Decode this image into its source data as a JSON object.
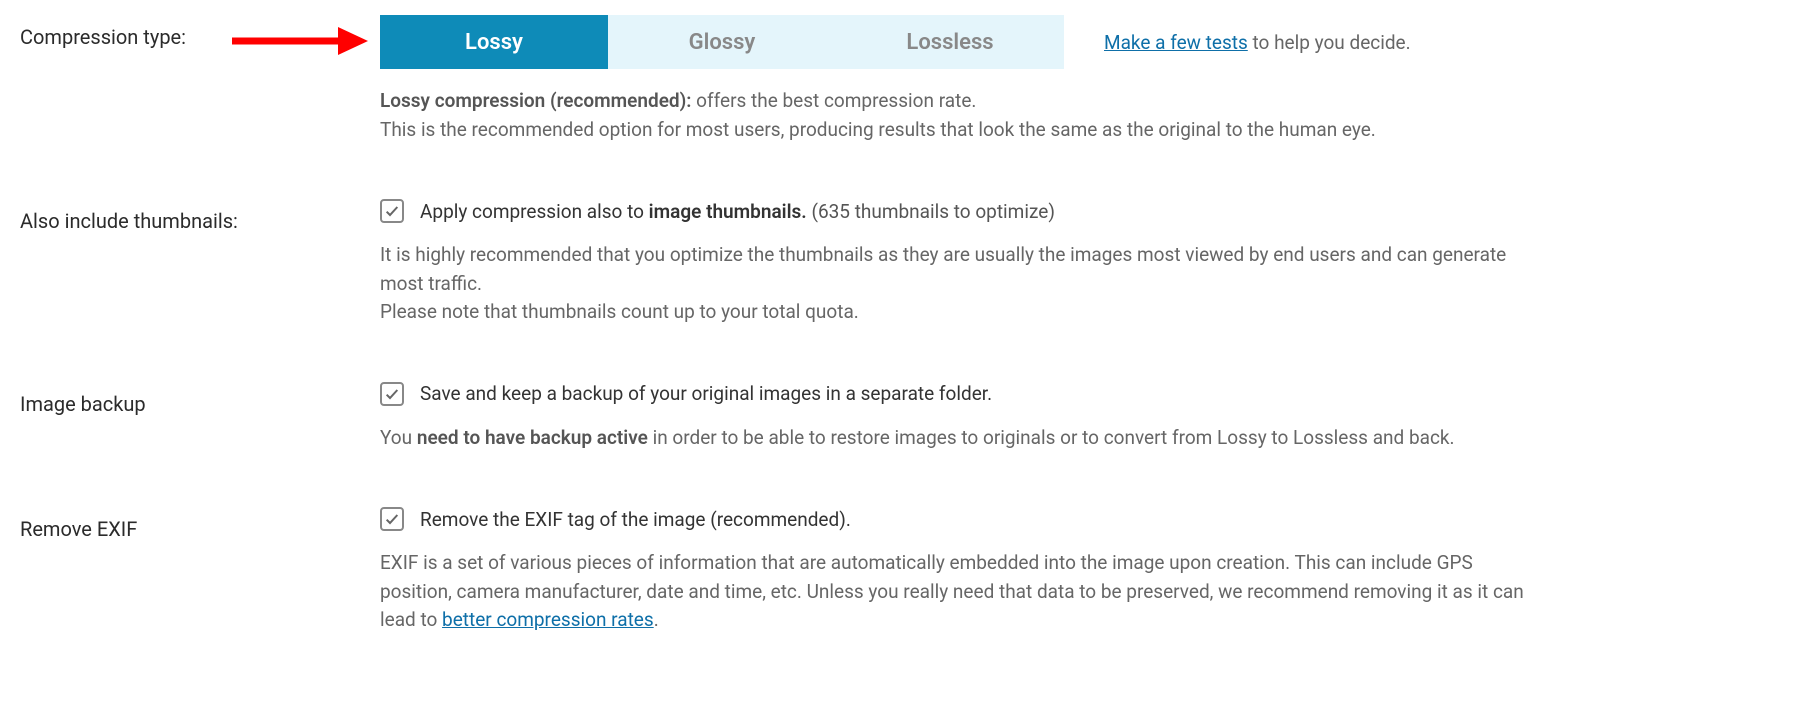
{
  "compression": {
    "label": "Compression type:",
    "tabs": {
      "lossy": "Lossy",
      "glossy": "Glossy",
      "lossless": "Lossless"
    },
    "right": {
      "link": "Make a few tests",
      "after": " to help you decide."
    },
    "desc_bold": "Lossy compression (recommended):",
    "desc_after": " offers the best compression rate.",
    "desc_line2": "This is the recommended option for most users, producing results that look the same as the original to the human eye."
  },
  "thumbnails": {
    "label": "Also include thumbnails:",
    "check_pre": "Apply compression also to ",
    "check_bold": "image thumbnails.",
    "count_paren": "(635 thumbnails to optimize)",
    "desc1": "It is highly recommended that you optimize the thumbnails as they are usually the images most viewed by end users and can generate most traffic.",
    "desc2": "Please note that thumbnails count up to your total quota."
  },
  "backup": {
    "label": "Image backup",
    "check": "Save and keep a backup of your original images in a separate folder.",
    "desc_pre": "You ",
    "desc_bold": "need to have backup active",
    "desc_after": " in order to be able to restore images to originals or to convert from Lossy to Lossless and back."
  },
  "exif": {
    "label": "Remove EXIF",
    "check": "Remove the EXIF tag of the image (recommended).",
    "desc_pre": "EXIF is a set of various pieces of information that are automatically embedded into the image upon creation. This can include GPS position, camera manufacturer, date and time, etc. Unless you really need that data to be preserved, we recommend removing it as it can lead to ",
    "desc_link": "better compression rates",
    "desc_after": "."
  }
}
